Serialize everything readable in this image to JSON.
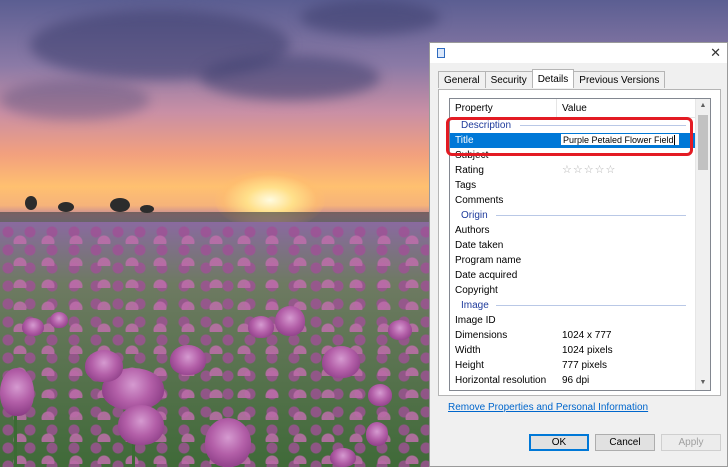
{
  "dialog": {
    "tabs": [
      "General",
      "Security",
      "Details",
      "Previous Versions"
    ],
    "active_tab": "Details",
    "close_glyph": "✕",
    "columns": {
      "property": "Property",
      "value": "Value"
    },
    "groups": {
      "description": "Description",
      "origin": "Origin",
      "image": "Image"
    },
    "description_rows": {
      "title": {
        "key": "Title",
        "value": "Purple Petaled Flower Field"
      },
      "subject": "Subject",
      "rating": {
        "key": "Rating",
        "value": "☆☆☆☆☆"
      },
      "tags": "Tags",
      "comments": "Comments"
    },
    "origin_rows": {
      "authors": "Authors",
      "date_taken": "Date taken",
      "program_name": "Program name",
      "date_acquired": "Date acquired",
      "copyright": "Copyright"
    },
    "image_rows": {
      "image_id": {
        "key": "Image ID",
        "value": ""
      },
      "dimensions": {
        "key": "Dimensions",
        "value": "1024 x 777"
      },
      "width": {
        "key": "Width",
        "value": "1024 pixels"
      },
      "height": {
        "key": "Height",
        "value": "777 pixels"
      },
      "horizontal_resolution": {
        "key": "Horizontal resolution",
        "value": "96 dpi"
      }
    },
    "remove_link": "Remove Properties and Personal Information",
    "buttons": {
      "ok": "OK",
      "cancel": "Cancel",
      "apply": "Apply"
    }
  },
  "colors": {
    "selection": "#0078d7",
    "highlight_box": "#e31b23",
    "group_header": "#1e3b9c",
    "link": "#0066cc"
  }
}
